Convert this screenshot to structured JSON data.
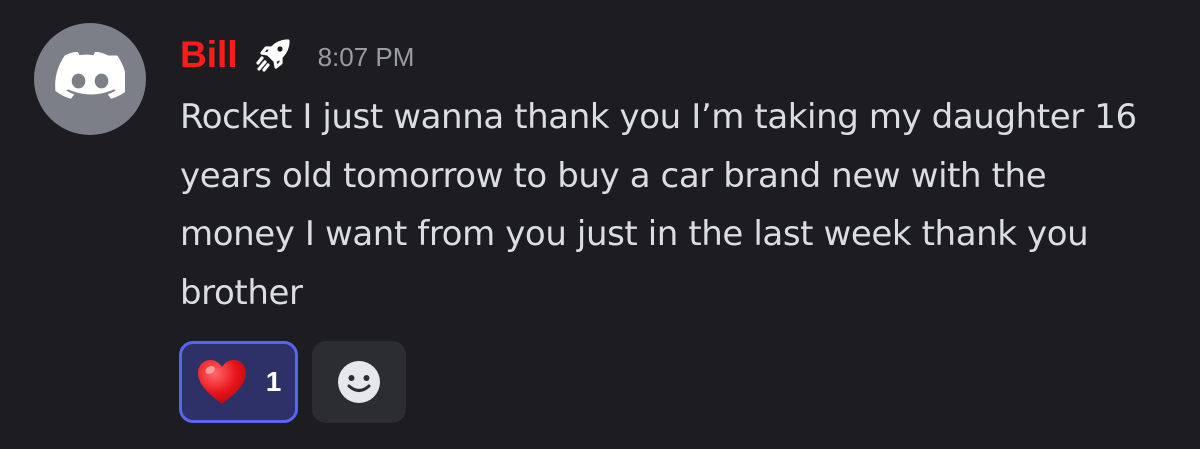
{
  "message": {
    "author": "Bill",
    "author_color": "#ff1b1b",
    "role_icon": "rocket-icon",
    "timestamp": "8:07 PM",
    "content": "Rocket I just wanna thank you I’m taking my daughter 16 years old tomorrow to buy a car brand new with the money I want from you just in the last week thank you brother",
    "avatar_icon": "discord-logo-icon"
  },
  "reactions": [
    {
      "emoji": "❤️",
      "emoji_name": "heart-icon",
      "count": "1",
      "selected": true
    }
  ],
  "add_reaction": {
    "icon": "smiley-icon"
  },
  "colors": {
    "background": "#1c1c21",
    "text": "#dbdee1",
    "timestamp": "#9b9ca3",
    "reaction_bg": "#2e3168",
    "reaction_border": "#5865f2"
  }
}
